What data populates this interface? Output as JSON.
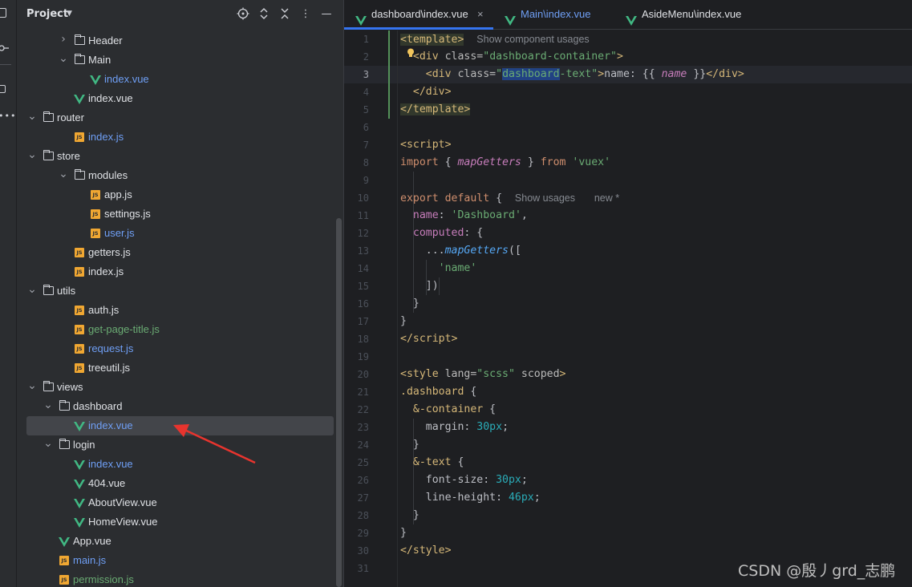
{
  "project_panel": {
    "title": "Project",
    "tree": [
      {
        "label": "Header",
        "type": "folder",
        "expanded": false,
        "color": "default"
      },
      {
        "label": "Main",
        "type": "folder",
        "expanded": true,
        "color": "default"
      },
      {
        "label": "index.vue",
        "type": "vue",
        "color": "blue"
      },
      {
        "label": "index.vue",
        "type": "vue",
        "color": "default"
      },
      {
        "label": "router",
        "type": "folder",
        "expanded": true,
        "color": "default"
      },
      {
        "label": "index.js",
        "type": "js",
        "color": "blue"
      },
      {
        "label": "store",
        "type": "folder",
        "expanded": true,
        "color": "default"
      },
      {
        "label": "modules",
        "type": "folder",
        "expanded": true,
        "color": "default"
      },
      {
        "label": "app.js",
        "type": "js",
        "color": "default"
      },
      {
        "label": "settings.js",
        "type": "js",
        "color": "default"
      },
      {
        "label": "user.js",
        "type": "js",
        "color": "blue"
      },
      {
        "label": "getters.js",
        "type": "js",
        "color": "default"
      },
      {
        "label": "index.js",
        "type": "js",
        "color": "default"
      },
      {
        "label": "utils",
        "type": "folder",
        "expanded": true,
        "color": "default"
      },
      {
        "label": "auth.js",
        "type": "js",
        "color": "default"
      },
      {
        "label": "get-page-title.js",
        "type": "js",
        "color": "green"
      },
      {
        "label": "request.js",
        "type": "js",
        "color": "blue"
      },
      {
        "label": "treeutil.js",
        "type": "js",
        "color": "default"
      },
      {
        "label": "views",
        "type": "folder",
        "expanded": true,
        "color": "default"
      },
      {
        "label": "dashboard",
        "type": "folder",
        "expanded": true,
        "color": "default"
      },
      {
        "label": "index.vue",
        "type": "vue",
        "color": "blue",
        "selected": true
      },
      {
        "label": "login",
        "type": "folder",
        "expanded": true,
        "color": "default"
      },
      {
        "label": "index.vue",
        "type": "vue",
        "color": "blue"
      },
      {
        "label": "404.vue",
        "type": "vue",
        "color": "default"
      },
      {
        "label": "AboutView.vue",
        "type": "vue",
        "color": "default"
      },
      {
        "label": "HomeView.vue",
        "type": "vue",
        "color": "default"
      },
      {
        "label": "App.vue",
        "type": "vue",
        "color": "default"
      },
      {
        "label": "main.js",
        "type": "js",
        "color": "blue"
      },
      {
        "label": "permission.js",
        "type": "js",
        "color": "green"
      }
    ]
  },
  "tabs": [
    {
      "label": "dashboard\\index.vue",
      "active": true,
      "closable": true,
      "close_glyph": "×"
    },
    {
      "label": "Main\\index.vue",
      "active": false
    },
    {
      "label": "AsideMenu\\index.vue",
      "active": false
    }
  ],
  "editor": {
    "current_line": 3,
    "line_numbers": [
      "1",
      "2",
      "3",
      "4",
      "5",
      "6",
      "7",
      "8",
      "9",
      "10",
      "11",
      "12",
      "13",
      "14",
      "15",
      "16",
      "17",
      "18",
      "19",
      "20",
      "21",
      "22",
      "23",
      "24",
      "25",
      "26",
      "27",
      "28",
      "29",
      "30",
      "31"
    ],
    "hints": {
      "component_usages": "Show component usages",
      "usages": "Show usages",
      "new": "new *"
    }
  },
  "watermark": "CSDN @殷丿grd_志鹏",
  "colors": {
    "panel_bg": "#2b2d30",
    "editor_bg": "#1e1f22",
    "selection": "#43454a",
    "accent": "#3574f0",
    "vue_green": "#41b883",
    "js_yellow": "#f0a732",
    "arrow_red": "#e8342e"
  }
}
